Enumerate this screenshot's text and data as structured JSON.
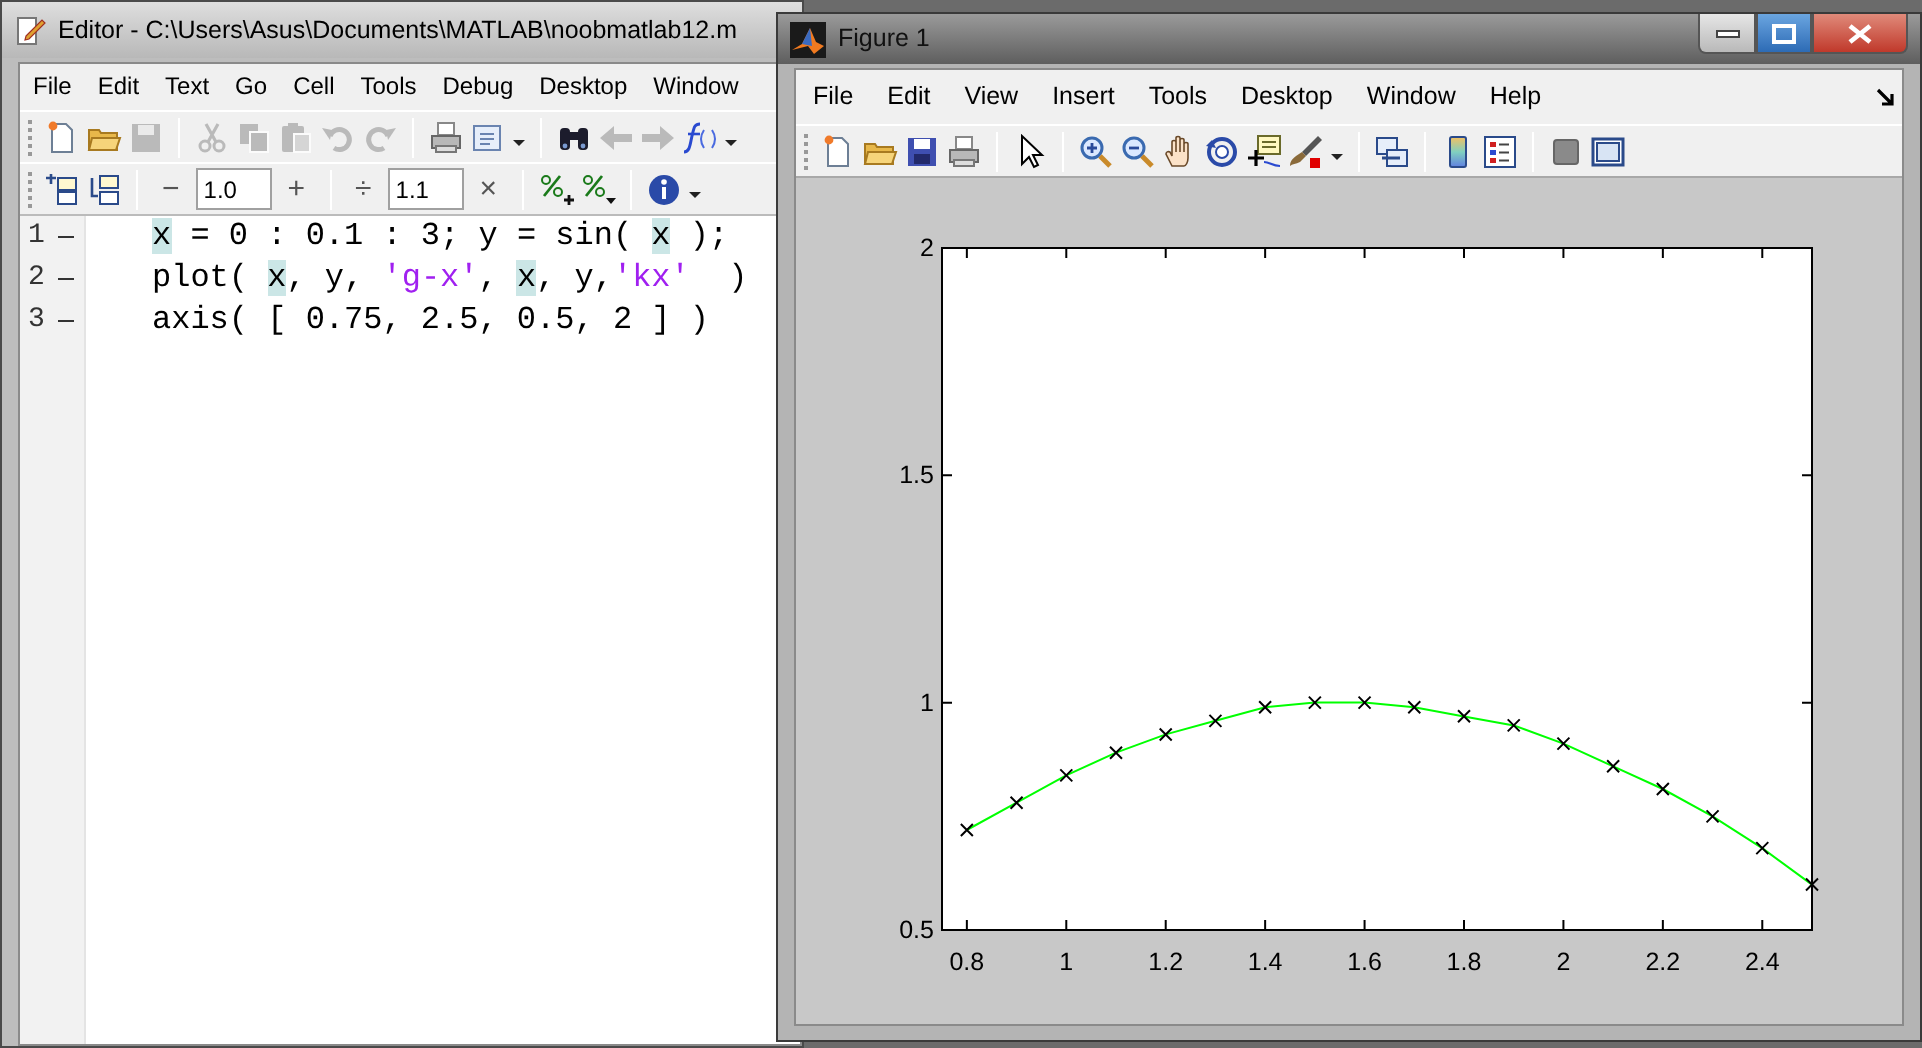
{
  "editor": {
    "title": "Editor - C:\\Users\\Asus\\Documents\\MATLAB\\noobmatlab12.m",
    "menu": [
      "File",
      "Edit",
      "Text",
      "Go",
      "Cell",
      "Tools",
      "Debug",
      "Desktop",
      "Window"
    ],
    "toolbar": [
      {
        "kind": "new",
        "disabled": false
      },
      {
        "kind": "open",
        "disabled": false
      },
      {
        "kind": "save",
        "disabled": true
      },
      {
        "kind": "separator"
      },
      {
        "kind": "cut",
        "disabled": true
      },
      {
        "kind": "copy",
        "disabled": true
      },
      {
        "kind": "paste",
        "disabled": true
      },
      {
        "kind": "undo",
        "disabled": true
      },
      {
        "kind": "redo",
        "disabled": true
      },
      {
        "kind": "separator"
      },
      {
        "kind": "print",
        "disabled": false
      },
      {
        "kind": "document",
        "disabled": false,
        "dropdown": true
      },
      {
        "kind": "separator"
      },
      {
        "kind": "find",
        "disabled": false
      },
      {
        "kind": "back",
        "disabled": true
      },
      {
        "kind": "forward",
        "disabled": true
      },
      {
        "kind": "function",
        "disabled": false,
        "dropdown": true
      }
    ],
    "cell_toolbar": [
      {
        "kind": "cellabove"
      },
      {
        "kind": "cellbelow"
      },
      {
        "kind": "separator"
      },
      {
        "kind": "text",
        "text": "−"
      },
      {
        "kind": "field",
        "value": "1.0"
      },
      {
        "kind": "text",
        "text": "+"
      },
      {
        "kind": "separator"
      },
      {
        "kind": "text",
        "text": "÷"
      },
      {
        "kind": "field",
        "value": "1.1"
      },
      {
        "kind": "text",
        "text": "×"
      },
      {
        "kind": "separator"
      },
      {
        "kind": "percentplus"
      },
      {
        "kind": "percentmenu"
      },
      {
        "kind": "separator"
      },
      {
        "kind": "info",
        "dropdown": true
      }
    ],
    "lines": [
      {
        "number": "1",
        "segments": [
          {
            "kind": "var",
            "text": "x"
          },
          {
            "kind": "plain",
            "text": " = 0 : 0.1 : 3; y = sin( "
          },
          {
            "kind": "var",
            "text": "x"
          },
          {
            "kind": "plain",
            "text": " );"
          }
        ]
      },
      {
        "number": "2",
        "segments": [
          {
            "kind": "plain",
            "text": "plot( "
          },
          {
            "kind": "var",
            "text": "x"
          },
          {
            "kind": "plain",
            "text": ", y, "
          },
          {
            "kind": "string",
            "text": "'g-x'"
          },
          {
            "kind": "plain",
            "text": ", "
          },
          {
            "kind": "var",
            "text": "x"
          },
          {
            "kind": "plain",
            "text": ", y,"
          },
          {
            "kind": "string",
            "text": "'kx'"
          },
          {
            "kind": "plain",
            "text": "  )"
          }
        ]
      },
      {
        "number": "3",
        "segments": [
          {
            "kind": "plain",
            "text": "axis( [ 0.75, 2.5, 0.5, 2 ] )"
          }
        ]
      }
    ]
  },
  "figure": {
    "title": "Figure 1",
    "menu": [
      "File",
      "Edit",
      "View",
      "Insert",
      "Tools",
      "Desktop",
      "Window",
      "Help"
    ],
    "toolbar": [
      {
        "kind": "new"
      },
      {
        "kind": "open"
      },
      {
        "kind": "savecolor"
      },
      {
        "kind": "print"
      },
      {
        "kind": "separator"
      },
      {
        "kind": "pointer"
      },
      {
        "kind": "separator"
      },
      {
        "kind": "zoomin"
      },
      {
        "kind": "zoomout"
      },
      {
        "kind": "pan"
      },
      {
        "kind": "rotate"
      },
      {
        "kind": "datacursor"
      },
      {
        "kind": "brush",
        "dropdown": true
      },
      {
        "kind": "separator"
      },
      {
        "kind": "link"
      },
      {
        "kind": "separator"
      },
      {
        "kind": "colorbar"
      },
      {
        "kind": "legend"
      },
      {
        "kind": "separator"
      },
      {
        "kind": "hidetools"
      },
      {
        "kind": "showtools"
      }
    ],
    "chart_data": {
      "type": "line",
      "xlim": [
        0.75,
        2.5
      ],
      "ylim": [
        0.5,
        2
      ],
      "xticks": [
        {
          "value": 0.8,
          "label": "0.8"
        },
        {
          "value": 1,
          "label": "1"
        },
        {
          "value": 1.2,
          "label": "1.2"
        },
        {
          "value": 1.4,
          "label": "1.4"
        },
        {
          "value": 1.6,
          "label": "1.6"
        },
        {
          "value": 1.8,
          "label": "1.8"
        },
        {
          "value": 2,
          "label": "2"
        },
        {
          "value": 2.2,
          "label": "2.2"
        },
        {
          "value": 2.4,
          "label": "2.4"
        }
      ],
      "yticks": [
        {
          "value": 0.5,
          "label": "0.5"
        },
        {
          "value": 1,
          "label": "1"
        },
        {
          "value": 1.5,
          "label": "1.5"
        },
        {
          "value": 2,
          "label": "2"
        }
      ],
      "x": [
        0.8,
        0.9,
        1.0,
        1.1,
        1.2,
        1.3,
        1.4,
        1.5,
        1.6,
        1.7,
        1.8,
        1.9,
        2.0,
        2.1,
        2.2,
        2.3,
        2.4,
        2.5
      ],
      "series": [
        {
          "color": "#00ff00",
          "marker": "cross",
          "values": [
            0.72,
            0.78,
            0.84,
            0.89,
            0.93,
            0.96,
            0.99,
            1.0,
            1.0,
            0.99,
            0.97,
            0.95,
            0.91,
            0.86,
            0.81,
            0.75,
            0.68,
            0.6
          ]
        }
      ]
    }
  }
}
